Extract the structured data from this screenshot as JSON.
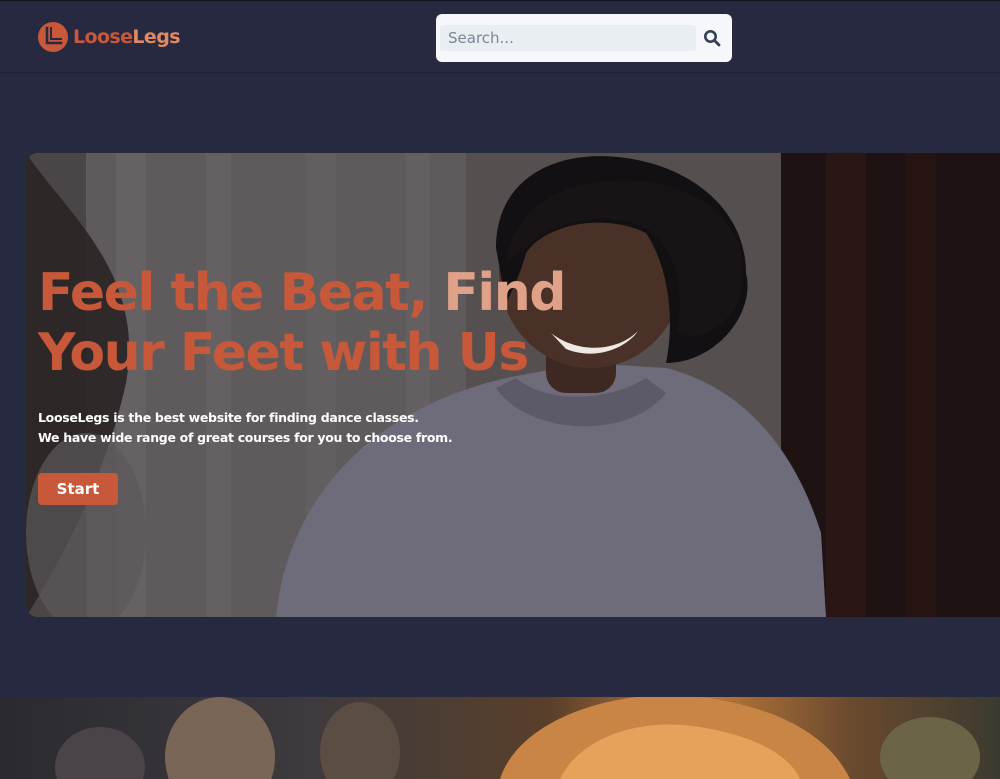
{
  "brand": {
    "name_part1": "Loose",
    "name_part2": "Legs",
    "logo_icon": "loose-legs-logo-icon",
    "primary_color": "#c8583a",
    "secondary_color": "#e08a63"
  },
  "search": {
    "placeholder": "Search...",
    "value": "",
    "icon": "search-icon"
  },
  "hero": {
    "title_line1_part1": "Feel the Beat, ",
    "title_line1_part2": "Find",
    "title_line2": "Your Feet with Us",
    "description_line1": "LooseLegs is the best website for finding dance classes.",
    "description_line2": "We have wide range of great courses for you to choose from.",
    "cta_label": "Start"
  },
  "colors": {
    "page_background": "#262940",
    "search_background": "#f5f7fa",
    "title_accent": "#e0a189"
  }
}
